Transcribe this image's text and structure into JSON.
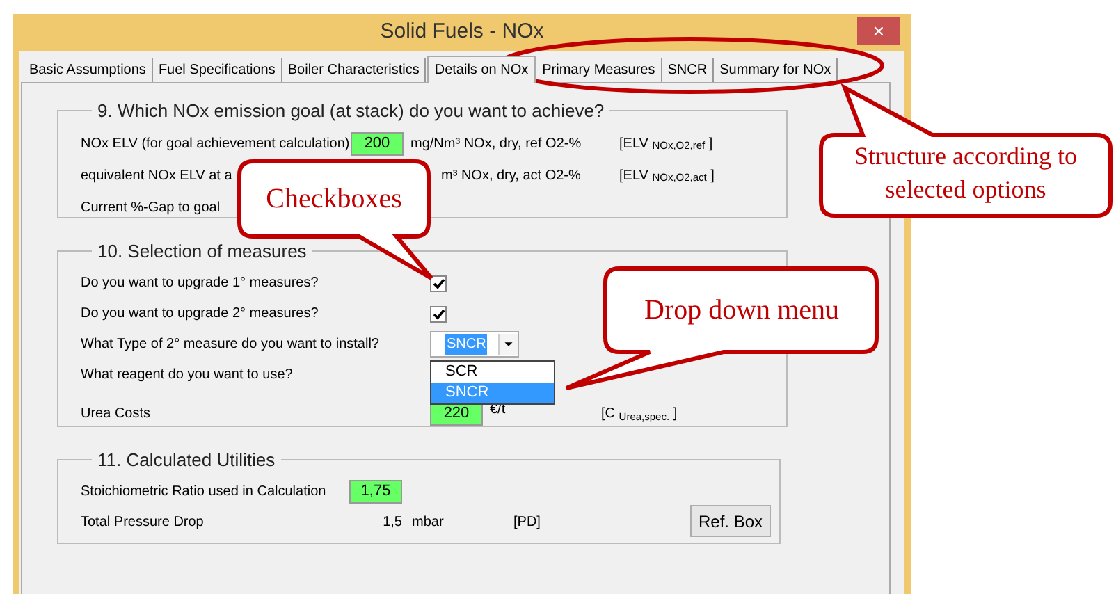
{
  "window": {
    "title": "Solid Fuels - NOx",
    "close": "×"
  },
  "tabs": [
    {
      "label": "Basic Assumptions",
      "selected": false
    },
    {
      "label": "Fuel Specifications",
      "selected": false
    },
    {
      "label": "Boiler Characteristics",
      "selected": false
    },
    {
      "label": "Details on NOx",
      "selected": true
    },
    {
      "label": "Primary Measures",
      "selected": false
    },
    {
      "label": "SNCR",
      "selected": false
    },
    {
      "label": "Summary for NOx",
      "selected": false
    }
  ],
  "goal_group": {
    "title": "9. Which NOx emission goal (at stack) do you want to achieve?",
    "rows": [
      {
        "label": "NOx ELV (for goal achievement calculation)",
        "value": "200",
        "unit": "mg/Nm³ NOx, dry, ref O2-%",
        "ref": "[ELV $_{NOx,O2,ref}$ ]"
      },
      {
        "label": "equivalent NOx ELV at a",
        "unit": "m³ NOx, dry, act O2-%",
        "ref": "[ELV $_{NOx,O2,act}$ ]"
      },
      {
        "label": "Current %-Gap to goal"
      }
    ]
  },
  "measures_group": {
    "title": "10. Selection of measures",
    "rows": [
      {
        "kind": "checkbox",
        "label": "Do you want to upgrade 1° measures?",
        "checked": true
      },
      {
        "kind": "checkbox",
        "label": "Do you want to upgrade 2° measures?",
        "checked": true
      },
      {
        "kind": "dropdown",
        "label": "What Type of 2° measure do you want to install?",
        "value": "SNCR",
        "options": [
          {
            "label": "SCR",
            "selected": false
          },
          {
            "label": "SNCR",
            "selected": true
          }
        ]
      },
      {
        "kind": "text",
        "label": "What reagent do you want to use?"
      },
      {
        "kind": "value",
        "label": "Urea Costs",
        "value": "220",
        "unit": "€/t",
        "ref": "[C $_{Urea,spec.}$ ]"
      }
    ]
  },
  "utilities_group": {
    "title": "11. Calculated Utilities",
    "rows": [
      {
        "kind": "value",
        "label": "Stoichiometric Ratio used in Calculation",
        "value": "1,75"
      },
      {
        "kind": "reading",
        "label": "Total Pressure Drop",
        "value": "1,5",
        "unit": "mbar",
        "ref": "[PD]"
      }
    ],
    "button": "Ref. Box"
  },
  "annotations": [
    {
      "text": "Checkboxes"
    },
    {
      "text": "Drop down menu"
    },
    {
      "text": "Structure according to selected options"
    }
  ]
}
